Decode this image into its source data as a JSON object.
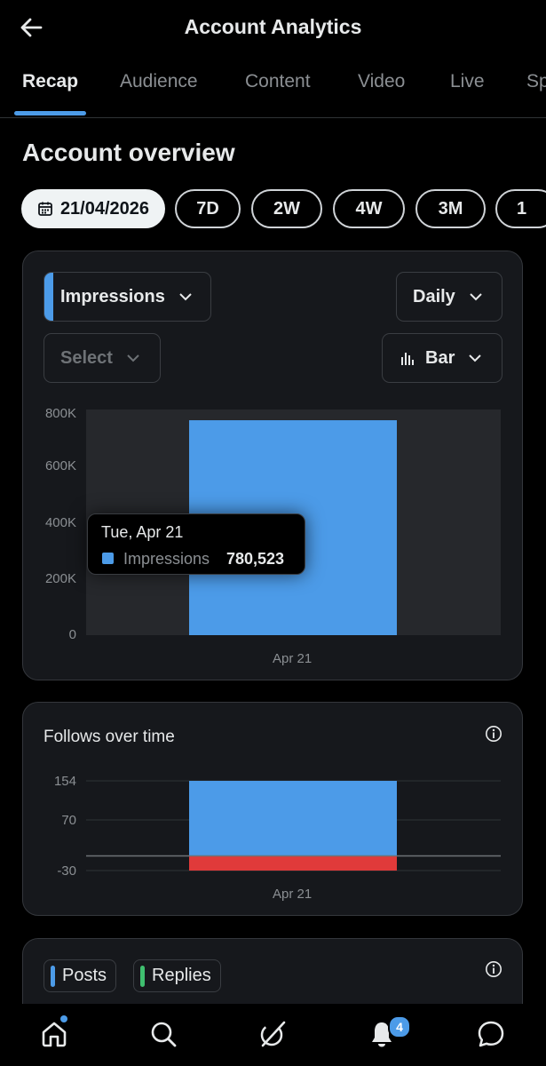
{
  "header": {
    "title": "Account Analytics"
  },
  "tabs": [
    "Recap",
    "Audience",
    "Content",
    "Video",
    "Live",
    "Sp"
  ],
  "section_title": "Account overview",
  "date_chips": {
    "selected": "21/04/2026",
    "options": [
      "7D",
      "2W",
      "4W",
      "3M",
      "1"
    ]
  },
  "impressions_card": {
    "metric_dropdown": "Impressions",
    "period_dropdown": "Daily",
    "compare_dropdown": "Select",
    "chart_type_dropdown": "Bar",
    "tooltip": {
      "date": "Tue, Apr 21",
      "label": "Impressions",
      "value": "780,523"
    }
  },
  "follows_card": {
    "title": "Follows over time"
  },
  "posts_card": {
    "legend": [
      "Posts",
      "Replies"
    ]
  },
  "bottom_nav": {
    "notification_count": "4"
  },
  "colors": {
    "accent": "#4c9be8",
    "negative": "#e03a3a",
    "replies": "#3fbf6f"
  },
  "chart_data": [
    {
      "type": "bar",
      "categories": [
        "Apr 21"
      ],
      "series": [
        {
          "name": "Impressions",
          "values": [
            780523
          ]
        }
      ],
      "yticks": [
        "800K",
        "600K",
        "400K",
        "200K",
        "0"
      ],
      "ylim": [
        0,
        800000
      ]
    },
    {
      "type": "bar",
      "title": "Follows over time",
      "categories": [
        "Apr 21"
      ],
      "series": [
        {
          "values": [
            154
          ]
        },
        {
          "values": [
            -30
          ]
        }
      ],
      "yticks": [
        "154",
        "70",
        "-30"
      ],
      "ylim": [
        -30,
        154
      ]
    }
  ]
}
